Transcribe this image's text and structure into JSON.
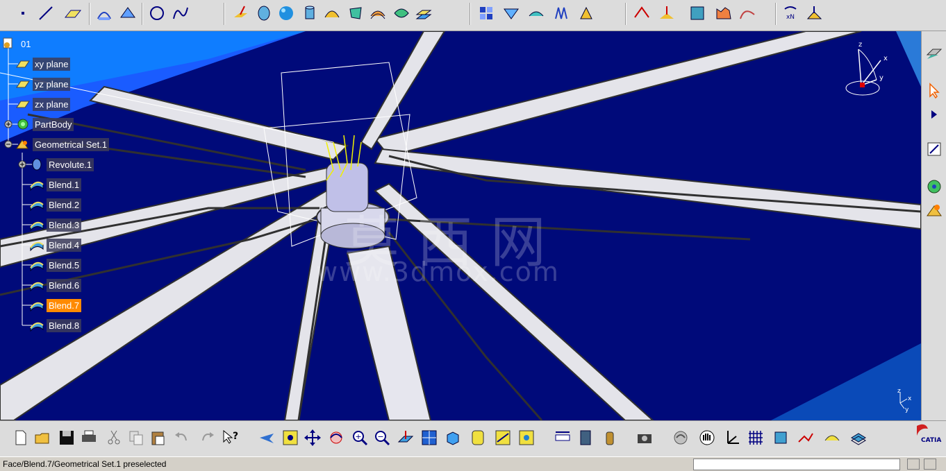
{
  "tree": {
    "root": "01",
    "nodes": [
      {
        "label": "xy plane",
        "icon": "plane-icon"
      },
      {
        "label": "yz plane",
        "icon": "plane-icon"
      },
      {
        "label": "zx plane",
        "icon": "plane-icon"
      },
      {
        "label": "PartBody",
        "icon": "partbody-icon"
      },
      {
        "label": "Geometrical Set.1",
        "icon": "geometrical-set-icon"
      },
      {
        "label": "Revolute.1",
        "icon": "revolute-icon"
      },
      {
        "label": "Blend.1",
        "icon": "blend-icon"
      },
      {
        "label": "Blend.2",
        "icon": "blend-icon"
      },
      {
        "label": "Blend.3",
        "icon": "blend-icon"
      },
      {
        "label": "Blend.4",
        "icon": "blend-icon"
      },
      {
        "label": "Blend.5",
        "icon": "blend-icon"
      },
      {
        "label": "Blend.6",
        "icon": "blend-icon"
      },
      {
        "label": "Blend.7",
        "icon": "blend-icon",
        "selected": true
      },
      {
        "label": "Blend.8",
        "icon": "blend-icon"
      }
    ]
  },
  "watermark": {
    "chinese": "莫 西 网",
    "url": "www.3dmox.com"
  },
  "compass": {
    "x": "x",
    "y": "y",
    "z": "z"
  },
  "mini_axis": {
    "x": "x",
    "y": "y",
    "z": "z"
  },
  "status": {
    "message": "Face/Blend.7/Geometrical Set.1 preselected",
    "command_value": ""
  },
  "logo": {
    "text": "CATIA"
  },
  "colors": {
    "viewport_bg": "#000a7a",
    "selection": "#ff8a00",
    "surface": "#d8d8e0"
  },
  "toolbar_top_icons": [
    "point-icon",
    "line-icon",
    "plane-icon",
    "projection-icon",
    "intersection-icon",
    "circle-icon",
    "spline-icon",
    "extrude-icon",
    "revolve-icon",
    "sphere-icon",
    "cylinder-icon",
    "sweep-icon",
    "fill-icon",
    "multisection-icon",
    "blend-icon",
    "offset-icon",
    "join-icon",
    "split-icon",
    "trim-icon",
    "boundary-icon",
    "extract-icon",
    "translate-icon",
    "symmetry-icon",
    "extrapolate-icon",
    "law-icon",
    "connect-icon",
    "curvature-icon",
    "draft-analysis-icon",
    "porcupine-icon",
    "repetition-icon",
    "axis-icon"
  ],
  "toolbar_bottom_icons": [
    "new-icon",
    "open-icon",
    "save-icon",
    "print-icon",
    "cut-icon",
    "copy-icon",
    "paste-icon",
    "undo-icon",
    "redo-icon",
    "whats-this-icon",
    "fly-mode-icon",
    "fit-all-icon",
    "pan-icon",
    "rotate-icon",
    "zoom-in-icon",
    "zoom-out-icon",
    "normal-view-icon",
    "multi-view-icon",
    "iso-view-icon",
    "shading-icon",
    "hide-show-icon",
    "swap-visible-icon",
    "measure-icon",
    "properties-icon",
    "catalog-icon",
    "capture-icon",
    "update-icon",
    "manipulate-icon",
    "axis-system-icon",
    "grid-icon",
    "work-support-icon",
    "snap-icon",
    "sketcher-icon",
    "layer-icon"
  ],
  "right_bar_icons": [
    "sketch-icon",
    "select-icon",
    "expand-icon",
    "sketcher-tools-icon",
    "part-design-icon",
    "wireframe-icon"
  ]
}
